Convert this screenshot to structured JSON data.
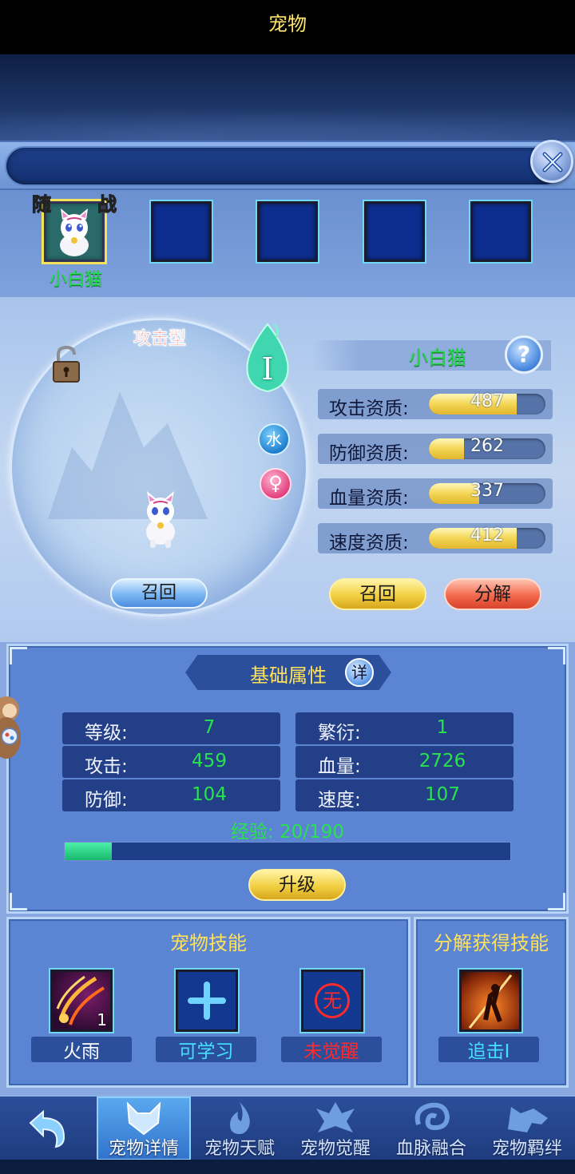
{
  "header": {
    "title": "宠物"
  },
  "slots": {
    "tag_follow": "随",
    "tag_battle": "战",
    "active_name": "小白猫"
  },
  "pet": {
    "type": "攻击型",
    "grade": "I",
    "element": "水",
    "gender": "♀",
    "name": "小白猫",
    "help": "?",
    "recall_orb": "召回"
  },
  "aptitudes": [
    {
      "label": "攻击资质:",
      "value": "487",
      "fill": 0.75
    },
    {
      "label": "防御资质:",
      "value": "262",
      "fill": 0.3
    },
    {
      "label": "血量资质:",
      "value": "337",
      "fill": 0.43
    },
    {
      "label": "速度资质:",
      "value": "412",
      "fill": 0.75
    }
  ],
  "actions": {
    "recall": "召回",
    "decompose": "分解"
  },
  "attributes": {
    "title": "基础属性",
    "detail": "详",
    "stats": [
      {
        "label": "等级:",
        "value": "7"
      },
      {
        "label": "繁衍:",
        "value": "1"
      },
      {
        "label": "攻击:",
        "value": "459"
      },
      {
        "label": "血量:",
        "value": "2726"
      },
      {
        "label": "防御:",
        "value": "104"
      },
      {
        "label": "速度:",
        "value": "107"
      }
    ],
    "exp_text": "经验: 20/190",
    "exp_fraction": 0.105,
    "upgrade": "升级"
  },
  "skills": {
    "title": "宠物技能",
    "items": [
      {
        "name": "火雨",
        "level": "1",
        "color": "#ffffff"
      },
      {
        "name": "可学习",
        "color": "#45e0ff"
      },
      {
        "name": "未觉醒",
        "color": "#ff2a2a",
        "glyph": "无"
      }
    ],
    "decompose_title": "分解获得技能",
    "decompose_skill": {
      "name": "追击I",
      "color": "#45e0ff"
    }
  },
  "nav": {
    "tabs": [
      {
        "label": "宠物详情",
        "active": true
      },
      {
        "label": "宠物天赋"
      },
      {
        "label": "宠物觉醒"
      },
      {
        "label": "血脉融合"
      },
      {
        "label": "宠物羁绊"
      }
    ]
  },
  "colors": {
    "accent_gold": "#ffe15a",
    "stat_green": "#28e34c",
    "panel_blue": "#5b84d2"
  }
}
